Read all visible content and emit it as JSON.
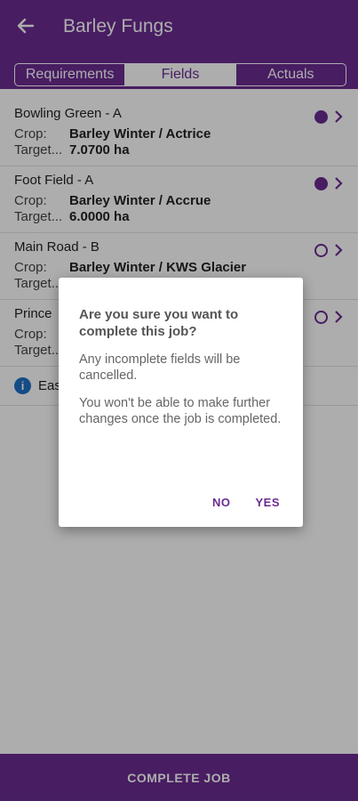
{
  "header": {
    "title": "Barley Fungs",
    "back_icon": "arrow-left-icon",
    "background": "#6a2c91"
  },
  "tabs": [
    {
      "label": "Requirements",
      "active": false
    },
    {
      "label": "Fields",
      "active": true
    },
    {
      "label": "Actuals",
      "active": false
    }
  ],
  "fields": [
    {
      "name": "Bowling Green - A",
      "crop_label": "Crop:",
      "crop": "Barley Winter / Actrice",
      "target_label": "Target...",
      "target": "7.0700 ha",
      "status": "filled"
    },
    {
      "name": "Foot Field - A",
      "crop_label": "Crop:",
      "crop": "Barley Winter / Accrue",
      "target_label": "Target...",
      "target": "6.0000 ha",
      "status": "filled"
    },
    {
      "name": "Main Road - B",
      "crop_label": "Crop:",
      "crop": "Barley Winter / KWS Glacier",
      "target_label": "Target...",
      "target": "",
      "status": "empty"
    },
    {
      "name": "Prince",
      "crop_label": "Crop:",
      "crop": "",
      "target_label": "Target...",
      "target": "",
      "status": "empty"
    }
  ],
  "info": {
    "icon": "info-icon",
    "text": "Eas"
  },
  "footer": {
    "button_label": "COMPLETE JOB"
  },
  "dialog": {
    "title": "Are you sure you want to complete this job?",
    "message_1": "Any incomplete fields will be cancelled.",
    "message_2": "You won't be able to make further changes once the job is completed.",
    "no_label": "NO",
    "yes_label": "YES"
  }
}
